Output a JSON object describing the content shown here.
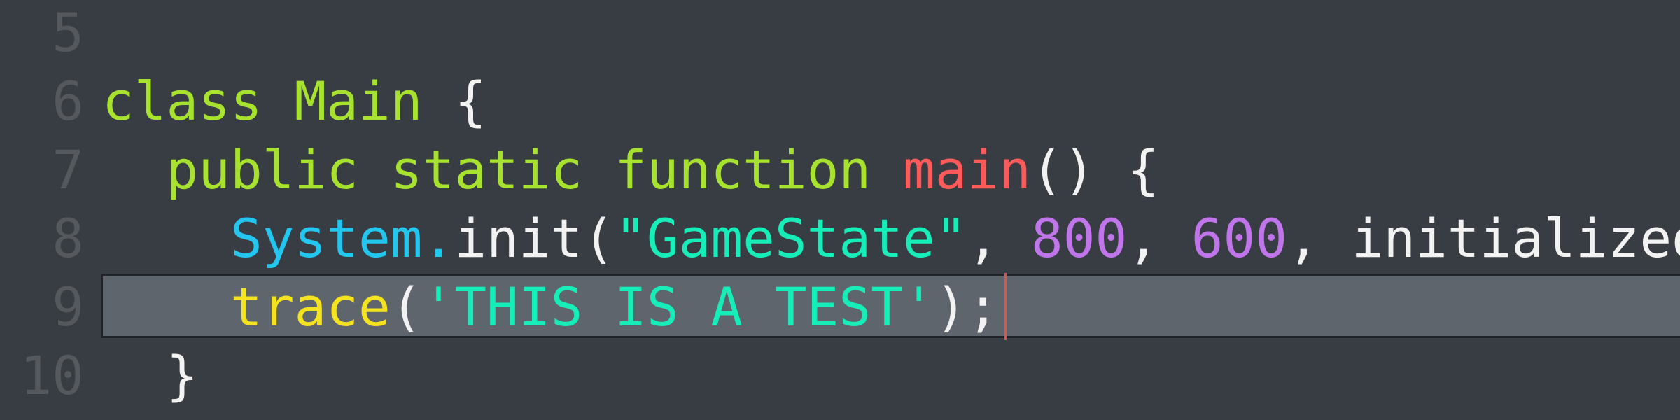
{
  "editor": {
    "line_numbers": [
      "5",
      "6",
      "7",
      "8",
      "9",
      "10"
    ],
    "line6": {
      "kw_class": "class",
      "class_name": "Main",
      "brace": "{"
    },
    "line7": {
      "indent": "  ",
      "kw_public": "public",
      "kw_static": "static",
      "kw_function": "function",
      "fn_name": "main",
      "parens_brace": "() {"
    },
    "line8": {
      "indent": "    ",
      "obj": "System",
      "dot": ".",
      "method": "init(",
      "arg_str": "\"GameState\"",
      "comma1": ", ",
      "arg_num1": "800",
      "comma2": ", ",
      "arg_num2": "600",
      "comma3": ", ",
      "arg_rest": "initialized"
    },
    "line9": {
      "indent": "    ",
      "fn": "trace",
      "open": "(",
      "arg_str": "'THIS IS A TEST'",
      "close": ");"
    },
    "line10": {
      "indent": "  ",
      "brace": "}"
    }
  },
  "colors": {
    "background": "#373d42",
    "current_line": "#5e656d",
    "gutter_text": "#55595d",
    "keyword": "#a6e22e",
    "function_name": "#ff5a5a",
    "builtin": "#22c6ee",
    "string": "#17edb9",
    "number": "#c075ea",
    "trace": "#f5e31f",
    "cursor": "#e85050"
  }
}
